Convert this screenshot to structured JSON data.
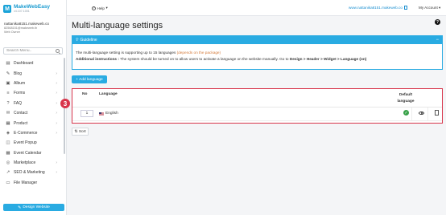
{
  "brand": {
    "name": "MakeWebEasy",
    "tagline": "v4.107.1001",
    "mark": "M",
    "color": "#1aa3d8"
  },
  "user": {
    "site": "nattanika8151.makeweb.co",
    "id": "82568151@makeweb.th",
    "role": "Web Owner"
  },
  "search": {
    "placeholder": "Search Menu.."
  },
  "sidebar": {
    "items": [
      {
        "label": "Dashboard",
        "icon": "dashboard-icon",
        "glyph": "▤",
        "has_children": false
      },
      {
        "label": "Blog",
        "icon": "blog-icon",
        "glyph": "✎",
        "has_children": true
      },
      {
        "label": "Album",
        "icon": "album-icon",
        "glyph": "▣",
        "has_children": true
      },
      {
        "label": "Forms",
        "icon": "forms-icon",
        "glyph": "≡",
        "has_children": true
      },
      {
        "label": "FAQ",
        "icon": "faq-icon",
        "glyph": "?",
        "has_children": true
      },
      {
        "label": "Contact",
        "icon": "contact-icon",
        "glyph": "✉",
        "has_children": true
      },
      {
        "label": "Product",
        "icon": "product-icon",
        "glyph": "▦",
        "has_children": true
      },
      {
        "label": "E-Commerce",
        "icon": "ecommerce-icon",
        "glyph": "◈",
        "has_children": true
      },
      {
        "label": "Event Popup",
        "icon": "popup-icon",
        "glyph": "◫",
        "has_children": false
      },
      {
        "label": "Event Calendar",
        "icon": "calendar-icon",
        "glyph": "▦",
        "has_children": false
      },
      {
        "label": "Marketplace",
        "icon": "marketplace-icon",
        "glyph": "◎",
        "has_children": true
      },
      {
        "label": "SEO & Marketing",
        "icon": "seo-icon",
        "glyph": "↗",
        "has_children": true
      },
      {
        "label": "File Manager",
        "icon": "folder-icon",
        "glyph": "▭",
        "has_children": false
      }
    ],
    "design_button": "Design Website"
  },
  "topbar": {
    "help_label": "Help",
    "site_link": "www.nattanika8151.makeweb.co",
    "account_label": "My Account"
  },
  "page": {
    "title": "Multi-language settings",
    "help_glyph": "?"
  },
  "guideline": {
    "title": "Guideline",
    "line1": "The multi-language setting is supporting up to 15 languages",
    "line1_note": "(depends on the package)",
    "line2_label": "Additional instructions :",
    "line2_text": " The system should be turned on to allow users to activate a language on the website manually. Go to ",
    "line2_path": "Design > Header > Widget > Language (on)",
    "accent": "#29abe2"
  },
  "add_button": "+ Add language",
  "table": {
    "headers": {
      "no": "No",
      "language": "Language",
      "default": "Default language"
    },
    "rows": [
      {
        "order": "1",
        "language": "English",
        "is_default": true
      }
    ],
    "highlight_color": "#d8344a"
  },
  "annotation_marker": "3",
  "sort_button": "Sort"
}
